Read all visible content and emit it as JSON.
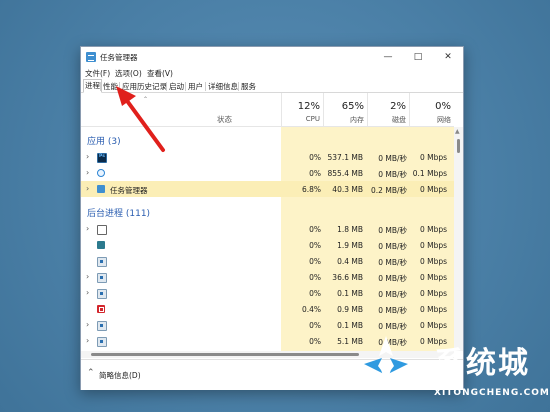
{
  "window": {
    "title": "任务管理器"
  },
  "menu": [
    "文件(F)",
    "选项(O)",
    "查看(V)"
  ],
  "tabs": [
    "进程",
    "性能",
    "应用历史记录",
    "启动",
    "用户",
    "详细信息",
    "服务"
  ],
  "header": {
    "status": "状态",
    "columns": [
      {
        "pct": "12%",
        "label": "CPU"
      },
      {
        "pct": "65%",
        "label": "内存"
      },
      {
        "pct": "2%",
        "label": "磁盘"
      },
      {
        "pct": "0%",
        "label": "网络"
      }
    ]
  },
  "groups": {
    "apps": "应用 (3)",
    "background": "后台进程 (111)"
  },
  "rows": [
    {
      "name": "",
      "icon": "photoshop-icon",
      "cpu": "0%",
      "mem": "537.1 MB",
      "disk": "0 MB/秒",
      "net": "0 Mbps"
    },
    {
      "name": "",
      "icon": "edge-icon",
      "cpu": "0%",
      "mem": "855.4 MB",
      "disk": "0 MB/秒",
      "net": "0.1 Mbps"
    },
    {
      "name": "任务管理器",
      "icon": "task-manager-icon",
      "cpu": "6.8%",
      "mem": "40.3 MB",
      "disk": "0.2 MB/秒",
      "net": "0 Mbps"
    },
    {
      "name": "",
      "icon": "notepad-icon",
      "cpu": "0%",
      "mem": "1.8 MB",
      "disk": "0 MB/秒",
      "net": "0 Mbps"
    },
    {
      "name": "",
      "icon": "service-icon",
      "cpu": "0%",
      "mem": "1.9 MB",
      "disk": "0 MB/秒",
      "net": "0 Mbps"
    },
    {
      "name": "",
      "icon": "service-icon",
      "cpu": "0%",
      "mem": "0.4 MB",
      "disk": "0 MB/秒",
      "net": "0 Mbps"
    },
    {
      "name": "",
      "icon": "service-icon",
      "cpu": "0%",
      "mem": "36.6 MB",
      "disk": "0 MB/秒",
      "net": "0 Mbps"
    },
    {
      "name": "",
      "icon": "service-icon",
      "cpu": "0%",
      "mem": "0.1 MB",
      "disk": "0 MB/秒",
      "net": "0 Mbps"
    },
    {
      "name": "",
      "icon": "amd-icon",
      "cpu": "0.4%",
      "mem": "0.9 MB",
      "disk": "0 MB/秒",
      "net": "0 Mbps"
    },
    {
      "name": "",
      "icon": "service-icon",
      "cpu": "0%",
      "mem": "0.1 MB",
      "disk": "0 MB/秒",
      "net": "0 Mbps"
    },
    {
      "name": "",
      "icon": "service-icon",
      "cpu": "0%",
      "mem": "5.1 MB",
      "disk": "0 MB/秒",
      "net": "0 Mbps"
    }
  ],
  "footer": {
    "label": "简略信息(D)"
  },
  "watermark": {
    "cn": "系统城",
    "en": "XITONGCHENG.COM"
  },
  "colors": {
    "heat": "#fdf3c8",
    "highlight": "#fbeeb6",
    "group_title": "#2a5db0",
    "annotation_arrow": "#e0201c"
  }
}
